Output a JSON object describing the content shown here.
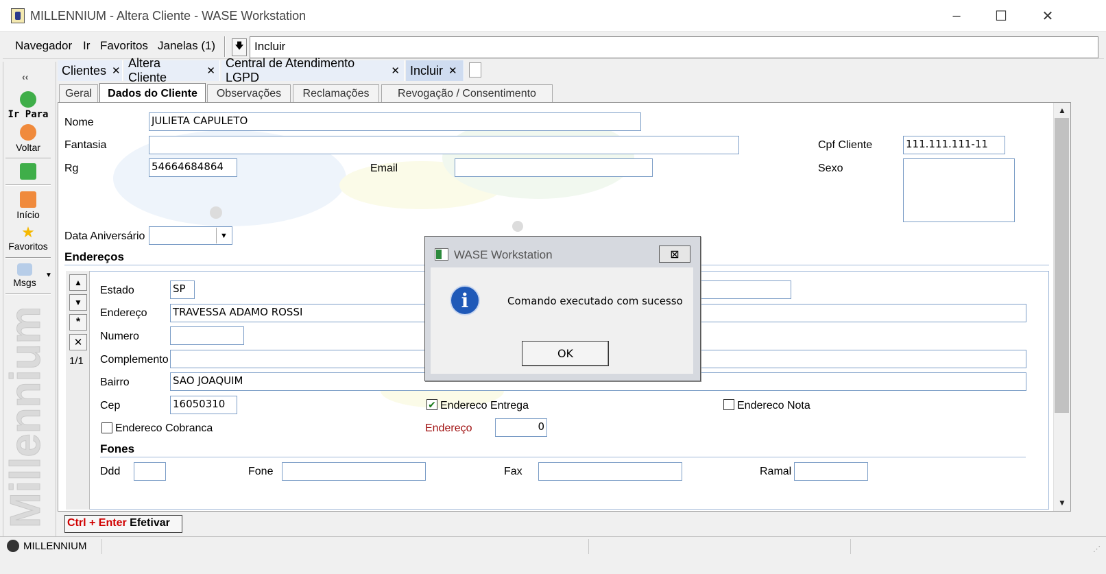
{
  "window": {
    "title": "MILLENNIUM - Altera Cliente - WASE Workstation",
    "controls": {
      "minimize": "–",
      "maximize": "☐",
      "close": "✕"
    }
  },
  "menu": {
    "items": [
      "Navegador",
      "Ir",
      "Favoritos",
      "Janelas (1)"
    ],
    "arrow": "🡇",
    "current_action": "Incluir"
  },
  "leftnav": {
    "collapse": "‹‹",
    "buttons": [
      {
        "label": "Ir Para",
        "icon": "arrow-right-icon",
        "color": "#3fae49"
      },
      {
        "label": "Voltar",
        "icon": "arrow-left-icon",
        "color": "#f08a3c"
      },
      {
        "label": "",
        "icon": "refresh-icon",
        "color": "#3fae49"
      },
      {
        "label": "Início",
        "icon": "home-icon",
        "color": "#f08a3c"
      },
      {
        "label": "Favoritos",
        "icon": "star-icon",
        "color": "#f5b800"
      },
      {
        "label": "Msgs",
        "icon": "messages-icon",
        "color": "#6fa0d8"
      }
    ],
    "brand": "Millennium"
  },
  "doc_tabs": [
    {
      "label": "Clientes"
    },
    {
      "label": "Altera Cliente"
    },
    {
      "label": "Central de Atendimento LGPD"
    },
    {
      "label": "Incluir"
    }
  ],
  "close_glyph": "✕",
  "sub_tabs": [
    "Geral",
    "Dados do Cliente",
    "Observações",
    "Reclamações",
    "Revogação / Consentimento"
  ],
  "form": {
    "nome": {
      "label": "Nome",
      "value": "JULIETA CAPULETO"
    },
    "fantasia": {
      "label": "Fantasia",
      "value": ""
    },
    "cpf": {
      "label": "Cpf Cliente",
      "value": "111.111.111-11"
    },
    "rg": {
      "label": "Rg",
      "value": "54664684864"
    },
    "email": {
      "label": "Email",
      "value": ""
    },
    "sexo": {
      "label": "Sexo",
      "value": ""
    },
    "aniversario": {
      "label": "Data Aniversário",
      "value": ""
    }
  },
  "enderecos": {
    "title": "Endereços",
    "nav": {
      "up": "▲",
      "down": "▼",
      "new": "*",
      "delete": "✕",
      "position": "1/1"
    },
    "estado": {
      "label": "Estado",
      "value": "SP"
    },
    "endereco": {
      "label": "Endereço",
      "value": "TRAVESSA ADAMO ROSSI"
    },
    "numero": {
      "label": "Numero",
      "value": ""
    },
    "complemento": {
      "label": "Complemento",
      "value": ""
    },
    "bairro": {
      "label": "Bairro",
      "value": "SAO JOAQUIM"
    },
    "cep": {
      "label": "Cep",
      "value": "16050310"
    },
    "endereco_entrega": {
      "label": "Endereco Entrega",
      "checked": true
    },
    "endereco_nota": {
      "label": "Endereco Nota",
      "checked": false
    },
    "endereco_cobranca": {
      "label": "Endereco Cobranca",
      "checked": false
    },
    "endereco_num": {
      "label": "Endereço",
      "value": "0"
    }
  },
  "fones": {
    "title": "Fones",
    "ddd": {
      "label": "Ddd",
      "value": ""
    },
    "fone": {
      "label": "Fone",
      "value": ""
    },
    "fax": {
      "label": "Fax",
      "value": ""
    },
    "ramal": {
      "label": "Ramal",
      "value": ""
    }
  },
  "efetivar": {
    "shortcut": "Ctrl + Enter",
    "label": "Efetivar"
  },
  "status": {
    "text": "MILLENNIUM"
  },
  "dialog": {
    "title": "WASE Workstation",
    "message": "Comando executado com sucesso",
    "ok": "OK",
    "close": "⊠"
  },
  "colors": {
    "tab_active": "#cfdcf0",
    "field_border": "#7a9cc6",
    "shortcut_red": "#d00000",
    "info_blue": "#1f59b8"
  }
}
